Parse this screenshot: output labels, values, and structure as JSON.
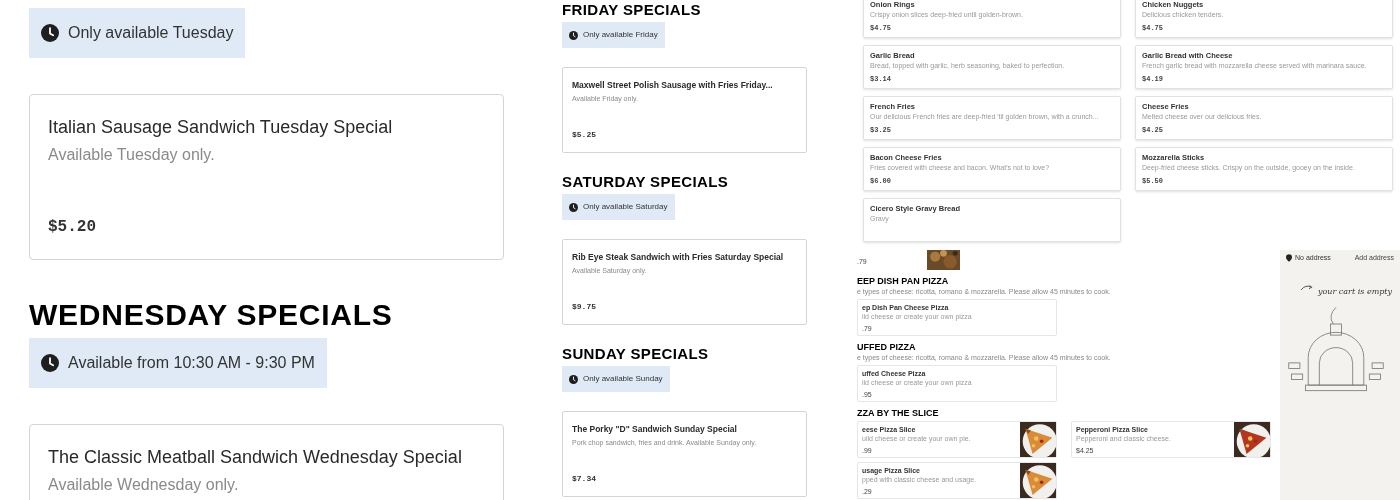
{
  "left_panel": {
    "sections": [
      {
        "badge": "Only available Tuesday",
        "items": [
          {
            "name": "Italian Sausage Sandwich Tuesday Special",
            "description": "Available Tuesday only.",
            "price": "$5.20"
          }
        ]
      },
      {
        "heading": "WEDNESDAY SPECIALS",
        "badge": "Available from 10:30 AM - 9:30 PM",
        "items": [
          {
            "name": "The Classic Meatball Sandwich Wednesday Special",
            "description": "Available Wednesday only."
          }
        ]
      }
    ]
  },
  "middle_panel": {
    "sections": [
      {
        "heading": "FRIDAY SPECIALS",
        "badge": "Only available Friday",
        "items": [
          {
            "name": "Maxwell Street Polish Sausage with Fries Friday...",
            "description": "Available Friday only.",
            "price": "$5.25"
          }
        ]
      },
      {
        "heading": "SATURDAY SPECIALS",
        "badge": "Only available Saturday",
        "items": [
          {
            "name": "Rib Eye Steak Sandwich with Fries Saturday Special",
            "description": "Available Saturday only.",
            "price": "$9.75"
          }
        ]
      },
      {
        "heading": "SUNDAY SPECIALS",
        "badge": "Only available Sunday",
        "items": [
          {
            "name": "The Porky \"D\" Sandwich Sunday Special",
            "description": "Pork chop sandwich, fries and drink. Available Sunday only.",
            "price": "$7.34"
          }
        ]
      }
    ]
  },
  "right_top_panel": {
    "items": [
      {
        "name": "Onion Rings",
        "description": "Crispy onion slices deep-fried until golden-brown.",
        "price": "$4.75"
      },
      {
        "name": "Chicken Nuggets",
        "description": "Delicious chicken tenders.",
        "price": "$4.75"
      },
      {
        "name": "Garlic Bread",
        "description": "Bread, topped with garlic, herb seasoning, baked to perfection.",
        "price": "$3.14"
      },
      {
        "name": "Garlic Bread with Cheese",
        "description": "French garlic bread with mozzarella cheese served with marinara sauce.",
        "price": "$4.19"
      },
      {
        "name": "French Fries",
        "description": "Our delicious French fries are deep-fried 'til golden brown, with a crunch...",
        "price": "$3.25"
      },
      {
        "name": "Cheese Fries",
        "description": "Melted cheese over our delicious fries.",
        "price": "$4.25"
      },
      {
        "name": "Bacon Cheese Fries",
        "description": "Fries covered with cheese and bacon. What's not to love?",
        "price": "$6.00"
      },
      {
        "name": "Mozzarella Sticks",
        "description": "Deep-fried cheese sticks. Crispy on the outside, gooey on the inside.",
        "price": "$5.50"
      },
      {
        "name": "Cicero Style Gravy Bread",
        "description": "Gravy"
      }
    ]
  },
  "right_bottom_panel": {
    "top_item": {
      "price": ".79",
      "kind": "picture"
    },
    "sections": [
      {
        "heading": "EEP DISH PAN PIZZA",
        "description": "e types of cheese: ricotta, romano & mozzarella. Please allow 45 minutes to cook.",
        "items": [
          {
            "name": "ep Dish Pan Cheese Pizza",
            "description": "ild cheese or create your own pizza",
            "price": ".79"
          }
        ]
      },
      {
        "heading": "UFFED PIZZA",
        "description": "e types of cheese: ricotta, romano & mozzarella. Please allow 45 minutes to cook.",
        "items": [
          {
            "name": "uffed Cheese Pizza",
            "description": "ild cheese or create your own pizza",
            "price": ".95"
          }
        ]
      },
      {
        "heading": "ZZA BY THE SLICE",
        "items": [
          {
            "name": "eese Pizza Slice",
            "description": "uild cheese or create your own pie.",
            "price": ".99",
            "kind": "picture"
          },
          {
            "name": "Pepperoni Pizza Slice",
            "description": "Pepperoni and classic cheese.",
            "price": "$4.25",
            "kind": "picture"
          },
          {
            "name": "usage Pizza Slice",
            "description": "pped with classic cheese and usage.",
            "price": ".29",
            "kind": "picture"
          }
        ]
      }
    ],
    "cart": {
      "address": "No address",
      "address_action": "Add address",
      "empty_message": "your cart is empty"
    }
  }
}
